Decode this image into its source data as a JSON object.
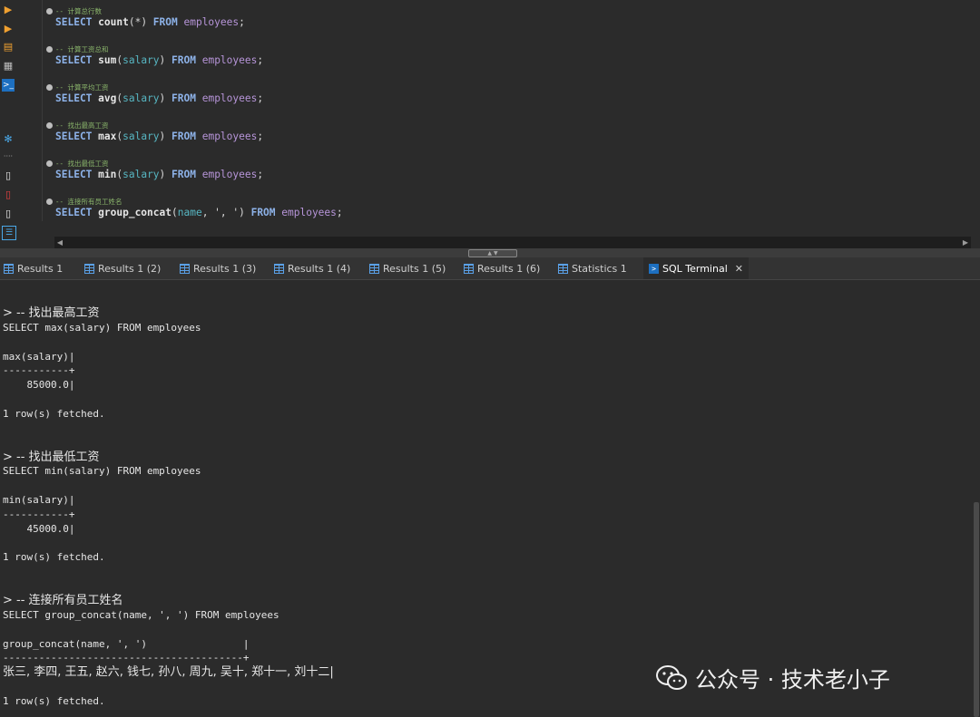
{
  "editor": {
    "lines": [
      {
        "comment": "-- 计算总行数",
        "sql": [
          [
            "kw",
            "SELECT "
          ],
          [
            "fn",
            "count"
          ],
          [
            "str",
            "(*) "
          ],
          [
            "kw",
            "FROM "
          ],
          [
            "tbl",
            "employees"
          ],
          [
            "str",
            ";"
          ]
        ]
      },
      {
        "comment": "-- 计算工资总和",
        "sql": [
          [
            "kw",
            "SELECT "
          ],
          [
            "fn",
            "sum"
          ],
          [
            "str",
            "("
          ],
          [
            "col",
            "salary"
          ],
          [
            "str",
            ") "
          ],
          [
            "kw",
            "FROM "
          ],
          [
            "tbl",
            "employees"
          ],
          [
            "str",
            ";"
          ]
        ]
      },
      {
        "comment": "-- 计算平均工资",
        "sql": [
          [
            "kw",
            "SELECT "
          ],
          [
            "fn",
            "avg"
          ],
          [
            "str",
            "("
          ],
          [
            "col",
            "salary"
          ],
          [
            "str",
            ") "
          ],
          [
            "kw",
            "FROM "
          ],
          [
            "tbl",
            "employees"
          ],
          [
            "str",
            ";"
          ]
        ]
      },
      {
        "comment": "-- 找出最高工资",
        "sql": [
          [
            "kw",
            "SELECT "
          ],
          [
            "fn",
            "max"
          ],
          [
            "str",
            "("
          ],
          [
            "col",
            "salary"
          ],
          [
            "str",
            ") "
          ],
          [
            "kw",
            "FROM "
          ],
          [
            "tbl",
            "employees"
          ],
          [
            "str",
            ";"
          ]
        ]
      },
      {
        "comment": "-- 找出最低工资",
        "sql": [
          [
            "kw",
            "SELECT "
          ],
          [
            "fn",
            "min"
          ],
          [
            "str",
            "("
          ],
          [
            "col",
            "salary"
          ],
          [
            "str",
            ") "
          ],
          [
            "kw",
            "FROM "
          ],
          [
            "tbl",
            "employees"
          ],
          [
            "str",
            ";"
          ]
        ]
      },
      {
        "comment": "-- 连接所有员工姓名",
        "sql": [
          [
            "kw",
            "SELECT "
          ],
          [
            "fn",
            "group_concat"
          ],
          [
            "str",
            "("
          ],
          [
            "col",
            "name"
          ],
          [
            "str",
            ", ', ') "
          ],
          [
            "kw",
            "FROM "
          ],
          [
            "tbl",
            "employees"
          ],
          [
            "str",
            ";"
          ]
        ]
      }
    ]
  },
  "tabs": [
    {
      "label": "Results 1",
      "icon": "grid-icon"
    },
    {
      "label": "Results 1 (2)",
      "icon": "grid-icon"
    },
    {
      "label": "Results 1 (3)",
      "icon": "grid-icon"
    },
    {
      "label": "Results 1 (4)",
      "icon": "grid-icon"
    },
    {
      "label": "Results 1 (5)",
      "icon": "grid-icon"
    },
    {
      "label": "Results 1 (6)",
      "icon": "grid-icon"
    },
    {
      "label": "Statistics 1",
      "icon": "grid-icon"
    },
    {
      "label": "SQL Terminal",
      "icon": "terminal-icon",
      "active": true,
      "close": "✕"
    }
  ],
  "terminal": {
    "lines": [
      "> -- 找出最高工资",
      "SELECT max(salary) FROM employees",
      "",
      "max(salary)|",
      "-----------+",
      "    85000.0|",
      "",
      "1 row(s) fetched.",
      "",
      "",
      "> -- 找出最低工资",
      "SELECT min(salary) FROM employees",
      "",
      "min(salary)|",
      "-----------+",
      "    45000.0|",
      "",
      "1 row(s) fetched.",
      "",
      "",
      "> -- 连接所有员工姓名",
      "SELECT group_concat(name, ', ') FROM employees",
      "",
      "group_concat(name, ', ')                |",
      "----------------------------------------+",
      "张三, 李四, 王五, 赵六, 钱七, 孙八, 周九, 吴十, 郑十一, 刘十二|",
      "",
      "1 row(s) fetched."
    ]
  },
  "watermark": {
    "text": "公众号 · 技术老小子"
  },
  "colors": {
    "keyword": "#8db2e8",
    "comment": "#8ab56b",
    "column": "#57b6c2",
    "table": "#b795d9",
    "accent": "#1d6fc0"
  }
}
